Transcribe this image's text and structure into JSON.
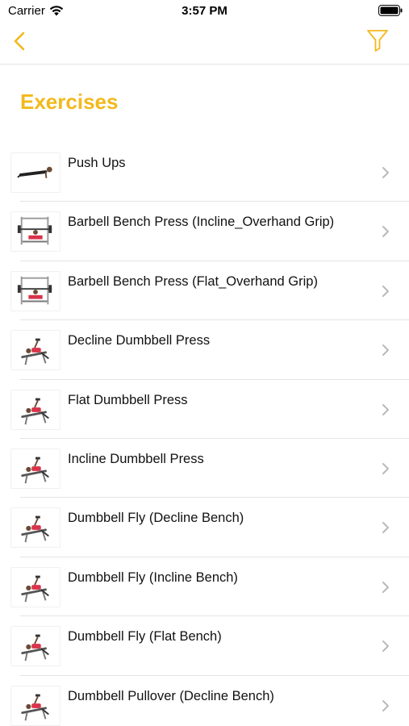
{
  "status_bar": {
    "carrier": "Carrier",
    "time": "3:57 PM",
    "icons": [
      "wifi-icon",
      "battery-icon"
    ]
  },
  "nav": {
    "back_icon": "chevron-left-icon",
    "filter_icon": "filter-funnel-icon",
    "accent_color": "#f2b91c"
  },
  "page": {
    "title": "Exercises"
  },
  "exercises": [
    {
      "name": "Push Ups",
      "thumbnail": "push-up-figure"
    },
    {
      "name": "Barbell Bench Press (Incline_Overhand Grip)",
      "thumbnail": "barbell-rack-figure"
    },
    {
      "name": "Barbell Bench Press (Flat_Overhand Grip)",
      "thumbnail": "barbell-rack-figure"
    },
    {
      "name": "Decline Dumbbell Press",
      "thumbnail": "bench-figure"
    },
    {
      "name": "Flat Dumbbell Press",
      "thumbnail": "bench-figure"
    },
    {
      "name": "Incline Dumbbell Press",
      "thumbnail": "bench-figure"
    },
    {
      "name": "Dumbbell Fly (Decline Bench)",
      "thumbnail": "bench-figure"
    },
    {
      "name": "Dumbbell Fly (Incline Bench)",
      "thumbnail": "bench-figure"
    },
    {
      "name": "Dumbbell Fly (Flat Bench)",
      "thumbnail": "bench-figure"
    },
    {
      "name": "Dumbbell Pullover (Decline Bench)",
      "thumbnail": "bench-figure"
    }
  ]
}
